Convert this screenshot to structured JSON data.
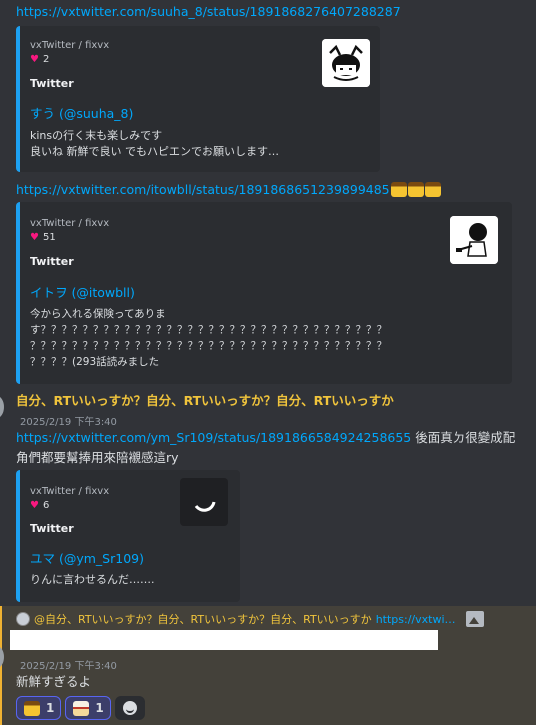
{
  "messages": {
    "link1": "https://vxtwitter.com/suuha_8/status/1891868276407288287",
    "embed1": {
      "provider": "vxTwitter / fixvx",
      "likes": "2",
      "source": "Twitter",
      "author": "すう (@suuha_8)",
      "desc": "kinsの行く末も楽しみです\n良いね 新鮮で良い でもハピエンでお願いします…"
    },
    "link2": "https://vxtwitter.com/itowbll/status/1891868651239899485",
    "embed2": {
      "provider": "vxTwitter / fixvx",
      "likes": "51",
      "source": "Twitter",
      "author": "イトヲ (@itowbll)",
      "desc": "今から入れる保険ってありま\nす？？？？？？？？？？？？？？？？？？？？？？？？？？？？？？？？？\n？？？？？？？？？？？？？？？？？？？？？？？？？？？？？？？？？？\n？？？？(293話読みました"
    },
    "yellow_line": "自分、RTいいっすか？自分、RTいいっすか？自分、RTいいっすか",
    "timestamp1": "2025/2/19 下午3:40",
    "link3": "https://vxtwitter.com/ym_Sr109/status/1891866584924258655",
    "link3_after": " 後面真ㄉ很變成配",
    "line2": "角們都要幫捧用來陪襯感這ry",
    "embed3": {
      "provider": "vxTwitter / fixvx",
      "likes": "6",
      "source": "Twitter",
      "author": "ユマ (@ym_Sr109)",
      "desc": "りんに言わせるんだ……."
    },
    "reply": {
      "text": "@自分、RTいいっすか？自分、RTいいっすか？自分、RTいいっすか",
      "link": "https://vxtwi…"
    },
    "timestamp2": "2025/2/19 下午3:40",
    "last_text": "新鮮すぎるよ",
    "reactions": [
      {
        "count": "1"
      },
      {
        "count": "1"
      }
    ]
  },
  "icons": [
    "pudding-emoji",
    "heart-icon",
    "image-icon",
    "add-reaction-icon"
  ],
  "colors": {
    "link": "#00a8fc",
    "mention": "#f0c43c",
    "embed_border": "#1da1f2",
    "bg": "#313338"
  }
}
